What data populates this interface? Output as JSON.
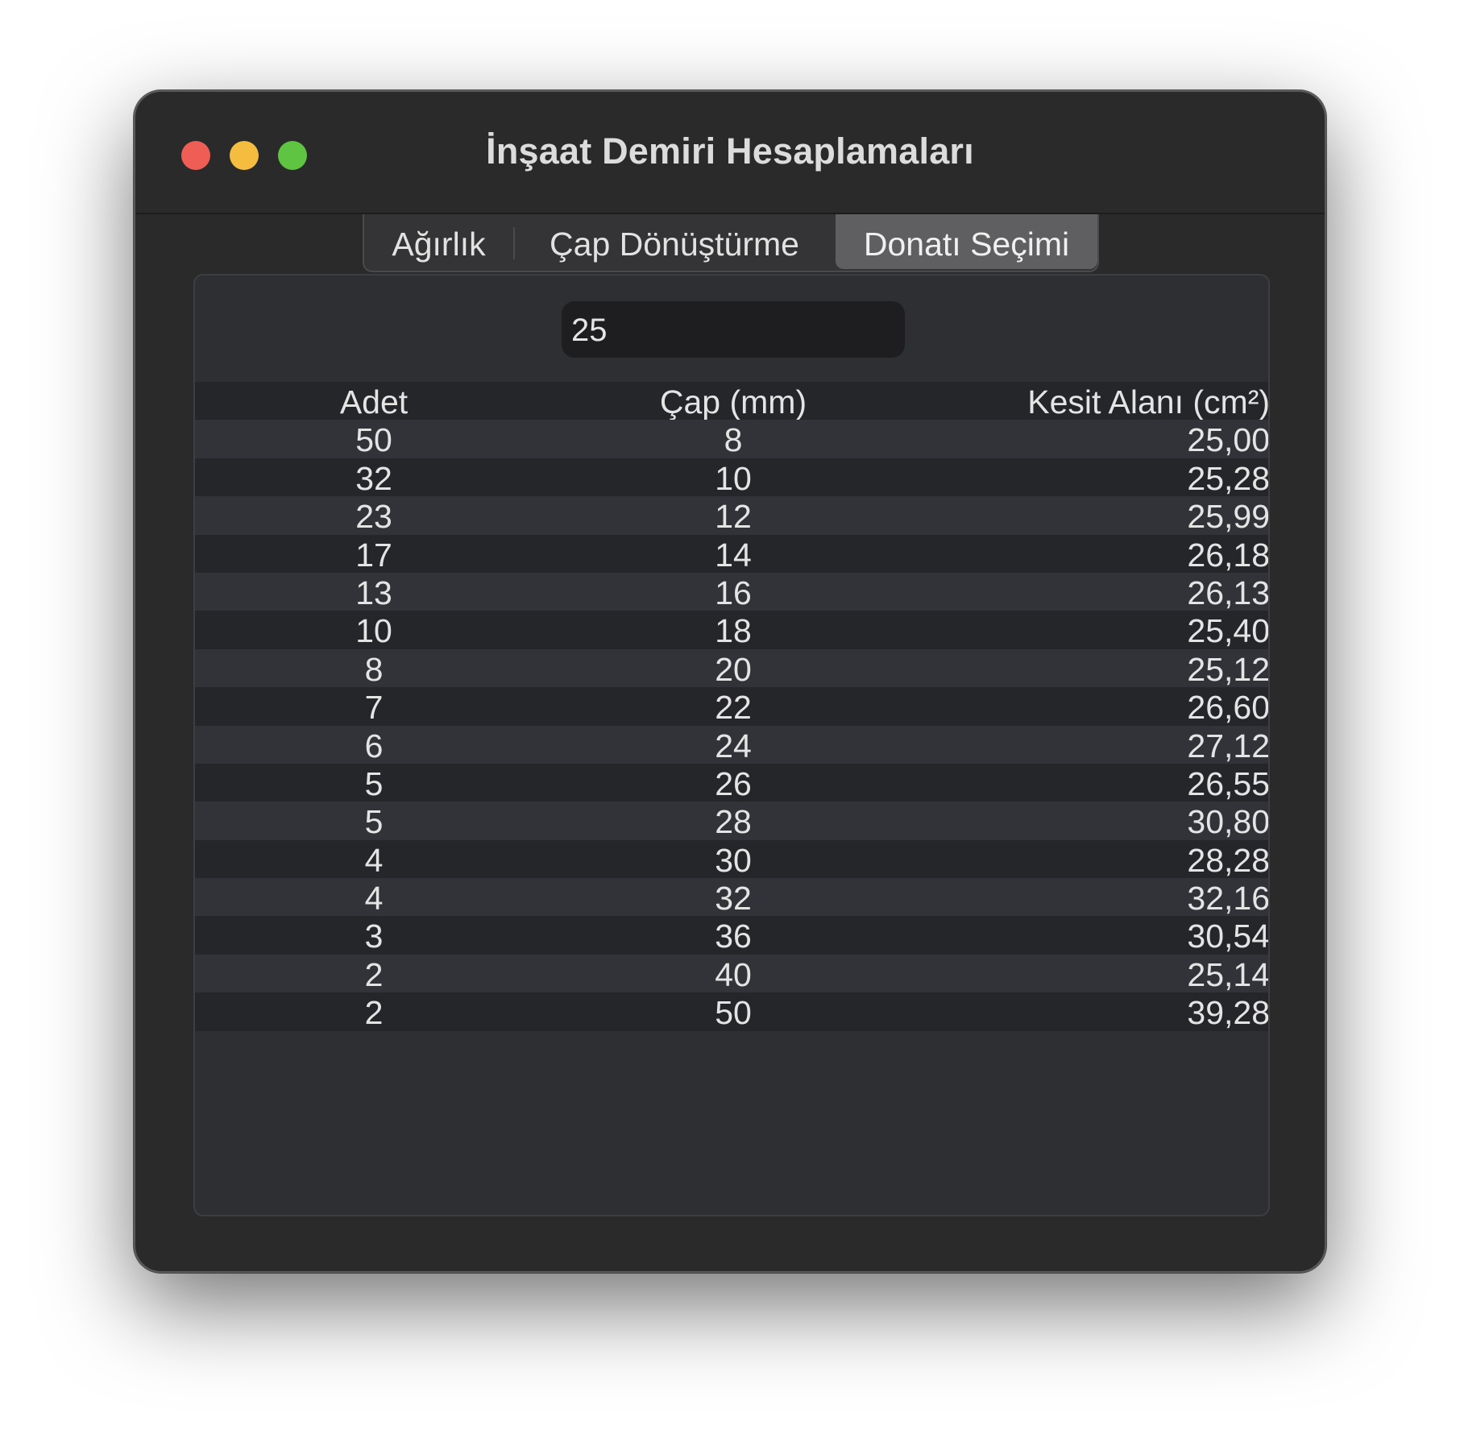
{
  "window": {
    "title": "İnşaat Demiri Hesaplamaları"
  },
  "tabs": [
    {
      "label": "Ağırlık",
      "selected": false
    },
    {
      "label": "Çap Dönüştürme",
      "selected": false
    },
    {
      "label": "Donatı Seçimi",
      "selected": true
    }
  ],
  "input": {
    "value": "25"
  },
  "table": {
    "headers": [
      "Adet",
      "Çap (mm)",
      "Kesit Alanı (cm²)"
    ],
    "rows": [
      [
        "50",
        "8",
        "25,00"
      ],
      [
        "32",
        "10",
        "25,28"
      ],
      [
        "23",
        "12",
        "25,99"
      ],
      [
        "17",
        "14",
        "26,18"
      ],
      [
        "13",
        "16",
        "26,13"
      ],
      [
        "10",
        "18",
        "25,40"
      ],
      [
        "8",
        "20",
        "25,12"
      ],
      [
        "7",
        "22",
        "26,60"
      ],
      [
        "6",
        "24",
        "27,12"
      ],
      [
        "5",
        "26",
        "26,55"
      ],
      [
        "5",
        "28",
        "30,80"
      ],
      [
        "4",
        "30",
        "28,28"
      ],
      [
        "4",
        "32",
        "32,16"
      ],
      [
        "3",
        "36",
        "30,54"
      ],
      [
        "2",
        "40",
        "25,14"
      ],
      [
        "2",
        "50",
        "39,28"
      ]
    ]
  },
  "colors": {
    "close": "#ee5e55",
    "minimize": "#f4bd3f",
    "zoom": "#5ec442"
  }
}
